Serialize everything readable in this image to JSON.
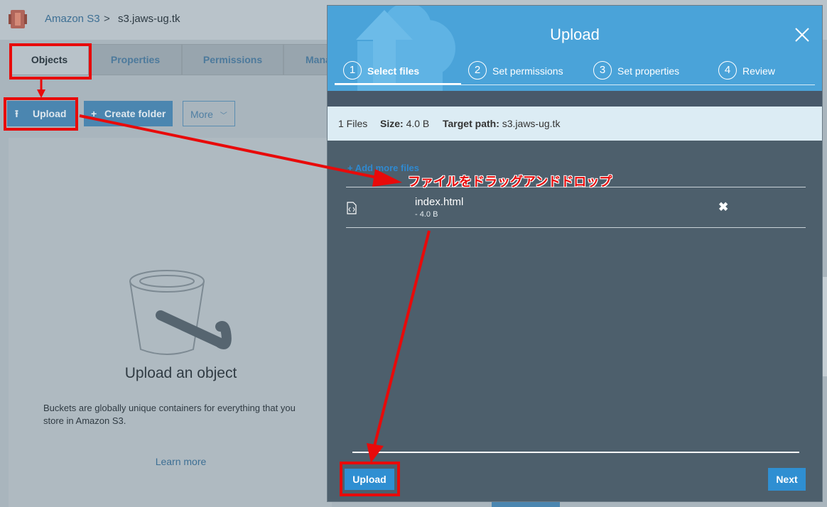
{
  "breadcrumb": {
    "service": "Amazon S3",
    "separator": ">",
    "bucket": "s3.jaws-ug.tk"
  },
  "tabs": [
    "Objects",
    "Properties",
    "Permissions",
    "Mana"
  ],
  "toolbar": {
    "upload_label": "Upload",
    "create_folder_label": "Create folder",
    "more_label": "More"
  },
  "empty_state": {
    "title": "Upload an object",
    "description": "Buckets are globally unique containers for everything that you store in Amazon S3.",
    "learn_more": "Learn more"
  },
  "modal": {
    "title": "Upload",
    "steps": [
      {
        "number": "1",
        "label": "Select files"
      },
      {
        "number": "2",
        "label": "Set permissions"
      },
      {
        "number": "3",
        "label": "Set properties"
      },
      {
        "number": "4",
        "label": "Review"
      }
    ],
    "active_step": 1,
    "summary": {
      "files": "1 Files",
      "size_label": "Size:",
      "size_value": "4.0 B",
      "path_label": "Target path:",
      "path_value": "s3.jaws-ug.tk"
    },
    "add_more_files": "+ Add more files",
    "file": {
      "name": "index.html",
      "size": "- 4.0 B"
    },
    "upload_button": "Upload",
    "next_button": "Next"
  },
  "annotation": {
    "text": "ファイルをドラッグアンドドロップ",
    "color": "#e80a0a"
  },
  "colors": {
    "accent": "#2f8fd2",
    "header": "#4aa3d9",
    "modal_body": "#4d5f6c"
  }
}
